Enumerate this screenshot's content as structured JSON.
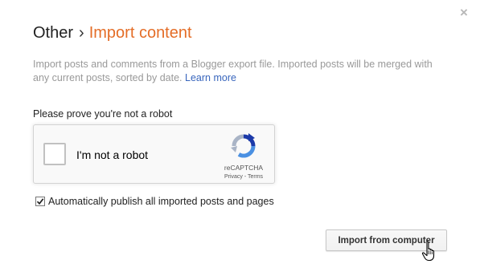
{
  "dialog": {
    "close_glyph": "×",
    "breadcrumb": {
      "parent": "Other",
      "separator": "›",
      "current": "Import content"
    },
    "description": {
      "text": "Import posts and comments from a Blogger export file. Imported posts will be merged with any current posts, sorted by date.",
      "link": "Learn more"
    }
  },
  "captcha": {
    "prompt": "Please prove you're not a robot",
    "checkbox_label": "I'm not a robot",
    "brand": "reCAPTCHA",
    "privacy": "Privacy",
    "terms_separator": " - ",
    "terms": "Terms",
    "icon": "recaptcha-logo-icon"
  },
  "options": {
    "auto_publish_label": "Automatically publish all imported posts and pages",
    "auto_publish_checked": true
  },
  "actions": {
    "import_label": "Import from computer"
  },
  "colors": {
    "accent_orange": "#e46d27",
    "link_blue": "#3966bd",
    "muted_text": "#999999"
  }
}
